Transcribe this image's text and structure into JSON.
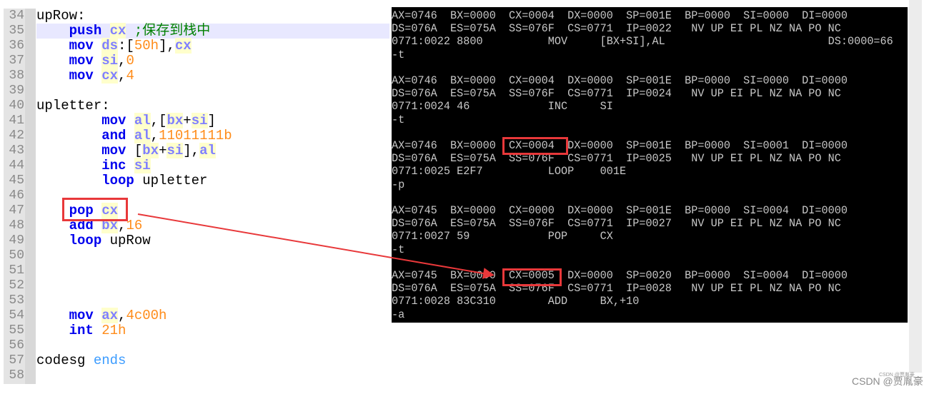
{
  "editor": {
    "current_line": "35",
    "lines": [
      {
        "n": "34",
        "indent": "",
        "tokens": [
          {
            "t": "upRow:",
            "c": "lbl"
          }
        ]
      },
      {
        "n": "35",
        "indent": "    ",
        "tokens": [
          {
            "t": "push",
            "c": "kw"
          },
          {
            "t": " ",
            "c": "pun"
          },
          {
            "t": "cx",
            "c": "reg"
          },
          {
            "t": " ",
            "c": "pun"
          },
          {
            "t": ";保存到栈中",
            "c": "cmt"
          }
        ]
      },
      {
        "n": "36",
        "indent": "    ",
        "tokens": [
          {
            "t": "mov",
            "c": "kw"
          },
          {
            "t": " ",
            "c": "pun"
          },
          {
            "t": "ds",
            "c": "reg"
          },
          {
            "t": ":[",
            "c": "pun"
          },
          {
            "t": "50h",
            "c": "num"
          },
          {
            "t": "],",
            "c": "pun"
          },
          {
            "t": "cx",
            "c": "reg"
          }
        ]
      },
      {
        "n": "37",
        "indent": "    ",
        "tokens": [
          {
            "t": "mov",
            "c": "kw"
          },
          {
            "t": " ",
            "c": "pun"
          },
          {
            "t": "si",
            "c": "reg"
          },
          {
            "t": ",",
            "c": "pun"
          },
          {
            "t": "0",
            "c": "num"
          }
        ]
      },
      {
        "n": "38",
        "indent": "    ",
        "tokens": [
          {
            "t": "mov",
            "c": "kw"
          },
          {
            "t": " ",
            "c": "pun"
          },
          {
            "t": "cx",
            "c": "reg"
          },
          {
            "t": ",",
            "c": "pun"
          },
          {
            "t": "4",
            "c": "num"
          }
        ]
      },
      {
        "n": "39",
        "indent": "",
        "tokens": []
      },
      {
        "n": "40",
        "indent": "",
        "tokens": [
          {
            "t": "upletter:",
            "c": "lbl"
          }
        ]
      },
      {
        "n": "41",
        "indent": "        ",
        "tokens": [
          {
            "t": "mov",
            "c": "kw"
          },
          {
            "t": " ",
            "c": "pun"
          },
          {
            "t": "al",
            "c": "reg"
          },
          {
            "t": ",[",
            "c": "pun"
          },
          {
            "t": "bx",
            "c": "reg"
          },
          {
            "t": "+",
            "c": "pun"
          },
          {
            "t": "si",
            "c": "reg"
          },
          {
            "t": "]",
            "c": "pun"
          }
        ]
      },
      {
        "n": "42",
        "indent": "        ",
        "tokens": [
          {
            "t": "and",
            "c": "kw"
          },
          {
            "t": " ",
            "c": "pun"
          },
          {
            "t": "al",
            "c": "reg"
          },
          {
            "t": ",",
            "c": "pun"
          },
          {
            "t": "11011111b",
            "c": "num"
          }
        ]
      },
      {
        "n": "43",
        "indent": "        ",
        "tokens": [
          {
            "t": "mov",
            "c": "kw"
          },
          {
            "t": " [",
            "c": "pun"
          },
          {
            "t": "bx",
            "c": "reg"
          },
          {
            "t": "+",
            "c": "pun"
          },
          {
            "t": "si",
            "c": "reg"
          },
          {
            "t": "],",
            "c": "pun"
          },
          {
            "t": "al",
            "c": "reg"
          }
        ]
      },
      {
        "n": "44",
        "indent": "        ",
        "tokens": [
          {
            "t": "inc",
            "c": "kw"
          },
          {
            "t": " ",
            "c": "pun"
          },
          {
            "t": "si",
            "c": "reg"
          }
        ]
      },
      {
        "n": "45",
        "indent": "        ",
        "tokens": [
          {
            "t": "loop",
            "c": "kw"
          },
          {
            "t": " upletter",
            "c": "lbl"
          }
        ]
      },
      {
        "n": "46",
        "indent": "",
        "tokens": []
      },
      {
        "n": "47",
        "indent": "    ",
        "tokens": [
          {
            "t": "pop",
            "c": "kw"
          },
          {
            "t": " ",
            "c": "pun"
          },
          {
            "t": "cx",
            "c": "reg"
          }
        ]
      },
      {
        "n": "48",
        "indent": "    ",
        "tokens": [
          {
            "t": "add",
            "c": "kw"
          },
          {
            "t": " ",
            "c": "pun"
          },
          {
            "t": "bx",
            "c": "reg"
          },
          {
            "t": ",",
            "c": "pun"
          },
          {
            "t": "16",
            "c": "num"
          }
        ]
      },
      {
        "n": "49",
        "indent": "    ",
        "tokens": [
          {
            "t": "loop",
            "c": "kw"
          },
          {
            "t": " upRow",
            "c": "lbl"
          }
        ]
      },
      {
        "n": "50",
        "indent": "",
        "tokens": []
      },
      {
        "n": "51",
        "indent": "",
        "tokens": []
      },
      {
        "n": "52",
        "indent": "",
        "tokens": []
      },
      {
        "n": "53",
        "indent": "",
        "tokens": []
      },
      {
        "n": "54",
        "indent": "    ",
        "tokens": [
          {
            "t": "mov",
            "c": "kw"
          },
          {
            "t": " ",
            "c": "pun"
          },
          {
            "t": "ax",
            "c": "reg"
          },
          {
            "t": ",",
            "c": "pun"
          },
          {
            "t": "4c00h",
            "c": "num"
          }
        ]
      },
      {
        "n": "55",
        "indent": "    ",
        "tokens": [
          {
            "t": "int",
            "c": "kw"
          },
          {
            "t": " ",
            "c": "pun"
          },
          {
            "t": "21h",
            "c": "num"
          }
        ]
      },
      {
        "n": "56",
        "indent": "",
        "tokens": []
      },
      {
        "n": "57",
        "indent": "",
        "tokens": [
          {
            "t": "codesg",
            "c": "lbl"
          },
          {
            "t": " ",
            "c": "pun"
          },
          {
            "t": "ends",
            "c": "dir"
          }
        ]
      },
      {
        "n": "58",
        "indent": "",
        "tokens": []
      }
    ]
  },
  "terminal": {
    "lines": [
      "AX=0746  BX=0000  CX=0004  DX=0000  SP=001E  BP=0000  SI=0000  DI=0000",
      "DS=076A  ES=075A  SS=076F  CS=0771  IP=0022   NV UP EI PL NZ NA PO NC",
      "0771:0022 8800          MOV     [BX+SI],AL                         DS:0000=66",
      "-t",
      "",
      "AX=0746  BX=0000  CX=0004  DX=0000  SP=001E  BP=0000  SI=0000  DI=0000",
      "DS=076A  ES=075A  SS=076F  CS=0771  IP=0024   NV UP EI PL NZ NA PO NC",
      "0771:0024 46            INC     SI",
      "-t",
      "",
      "AX=0746  BX=0000  CX=0004  DX=0000  SP=001E  BP=0000  SI=0001  DI=0000",
      "DS=076A  ES=075A  SS=076F  CS=0771  IP=0025   NV UP EI PL NZ NA PO NC",
      "0771:0025 E2F7          LOOP    001E",
      "-p",
      "",
      "AX=0745  BX=0000  CX=0000  DX=0000  SP=001E  BP=0000  SI=0004  DI=0000",
      "DS=076A  ES=075A  SS=076F  CS=0771  IP=0027   NV UP EI PL NZ NA PO NC",
      "0771:0027 59            POP     CX",
      "-t",
      "",
      "AX=0745  BX=0000  CX=0005  DX=0000  SP=0020  BP=0000  SI=0004  DI=0000",
      "DS=076A  ES=075A  SS=076F  CS=0771  IP=0028   NV UP EI PL NZ NA PO NC",
      "0771:0028 83C310        ADD     BX,+10",
      "-a"
    ]
  },
  "annotations": {
    "color": "#e8383a"
  },
  "watermark": {
    "main": "CSDN @贾胤豪",
    "small": "CSDN @贾胤豪"
  }
}
